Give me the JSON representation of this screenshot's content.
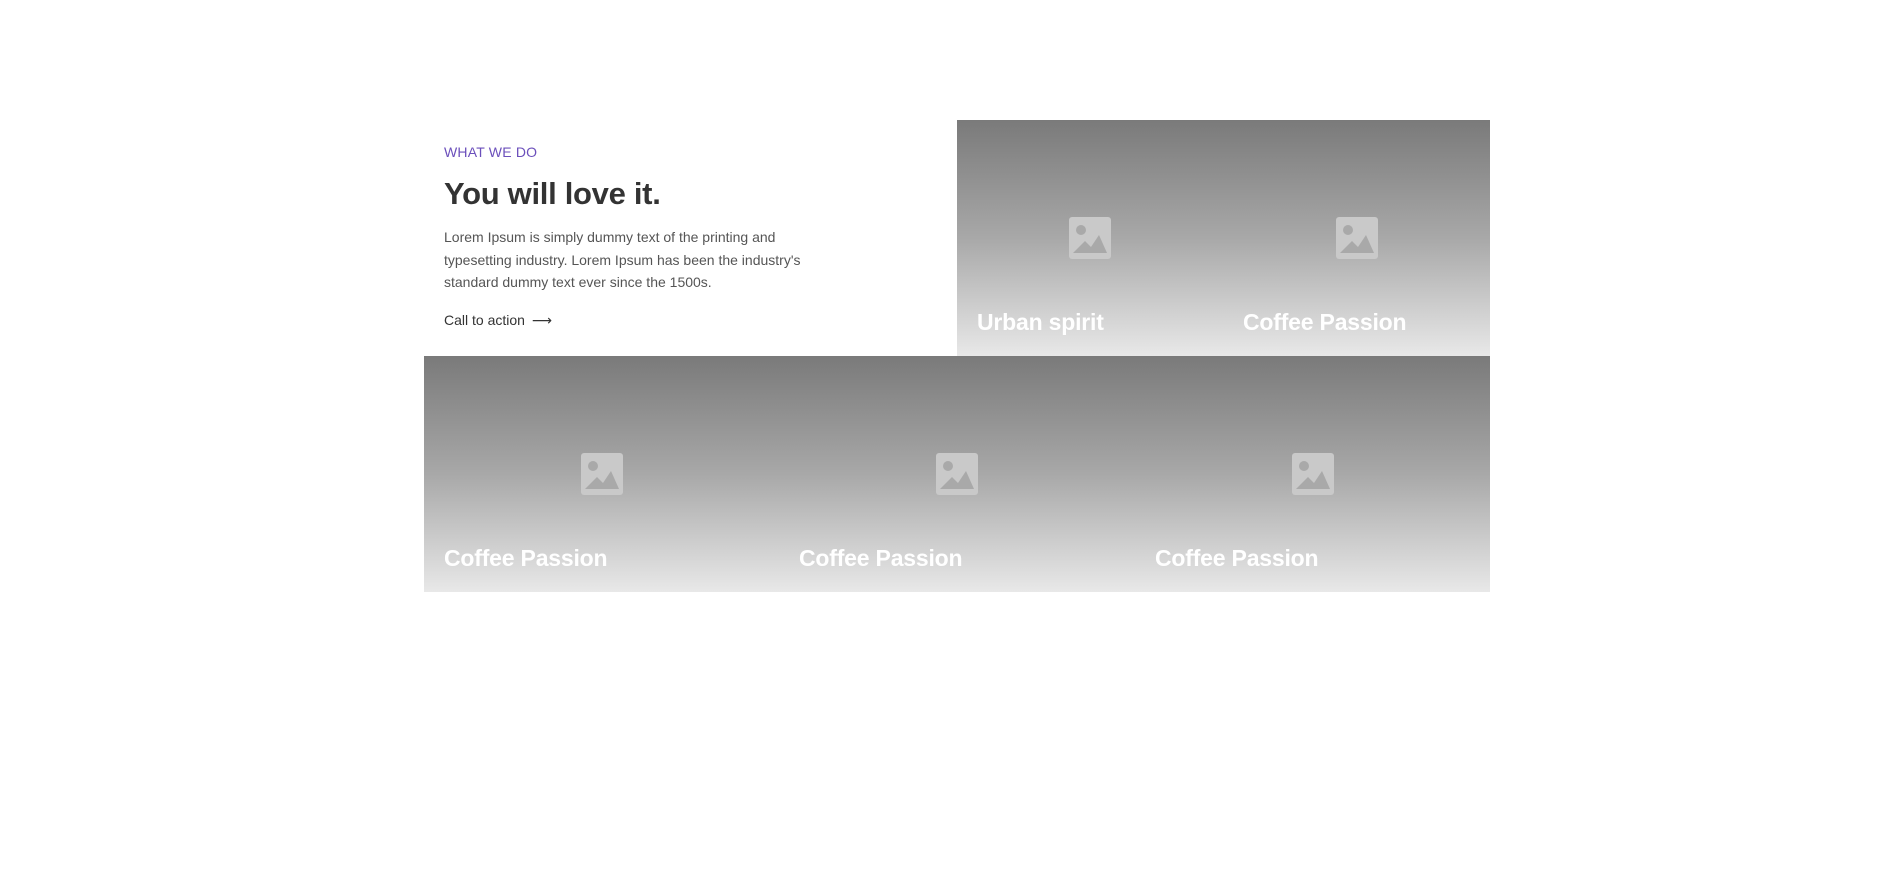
{
  "intro": {
    "eyebrow": "WHAT WE DO",
    "heading": "You will love it.",
    "body": "Lorem Ipsum is simply dummy text of the printing and typesetting industry. Lorem Ipsum has been the industry's standard dummy text ever since the 1500s.",
    "cta_label": "Call to action",
    "cta_arrow": "⟶"
  },
  "tiles": [
    {
      "title": "Urban spirit",
      "icon": "image-placeholder-icon"
    },
    {
      "title": "Coffee Passion",
      "icon": "image-placeholder-icon"
    },
    {
      "title": "Coffee Passion",
      "icon": "image-placeholder-icon"
    },
    {
      "title": "Coffee Passion",
      "icon": "image-placeholder-icon"
    },
    {
      "title": "Coffee Passion",
      "icon": "image-placeholder-icon"
    }
  ],
  "colors": {
    "eyebrow": "#6b4fbb",
    "heading": "#333333",
    "tile_title": "#ffffff"
  }
}
